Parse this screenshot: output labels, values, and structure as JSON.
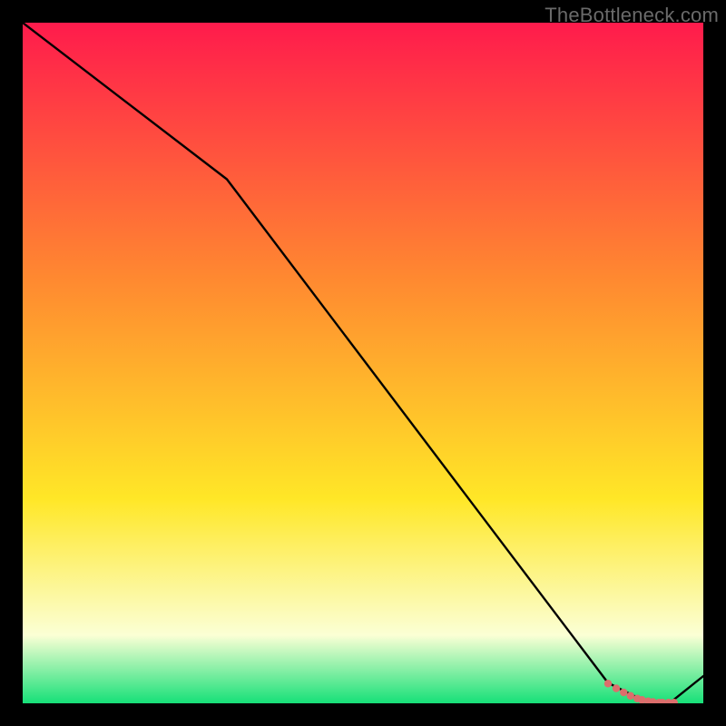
{
  "watermark": "TheBottleneck.com",
  "colors": {
    "frame": "#000000",
    "gradient_top": "#ff1b4c",
    "gradient_mid1": "#ff8a30",
    "gradient_mid2": "#ffe727",
    "gradient_low": "#fbffd5",
    "gradient_bottom": "#16e078",
    "curve": "#000000",
    "dots": "#dc6e6c"
  },
  "chart_data": {
    "type": "line",
    "title": "",
    "xlabel": "",
    "ylabel": "",
    "xlim": [
      0,
      100
    ],
    "ylim": [
      0,
      100
    ],
    "curve": {
      "x": [
        0,
        30,
        86,
        92,
        95,
        100
      ],
      "y": [
        100,
        77,
        3,
        0,
        0,
        4
      ]
    },
    "dots": {
      "x": [
        86.0,
        87.2,
        88.3,
        89.3,
        90.3,
        91.0,
        91.9,
        92.6,
        93.5,
        94.0,
        94.9,
        95.7
      ],
      "y": [
        2.9,
        2.2,
        1.6,
        1.1,
        0.7,
        0.5,
        0.3,
        0.2,
        0.1,
        0.1,
        0.1,
        0.1
      ]
    }
  }
}
